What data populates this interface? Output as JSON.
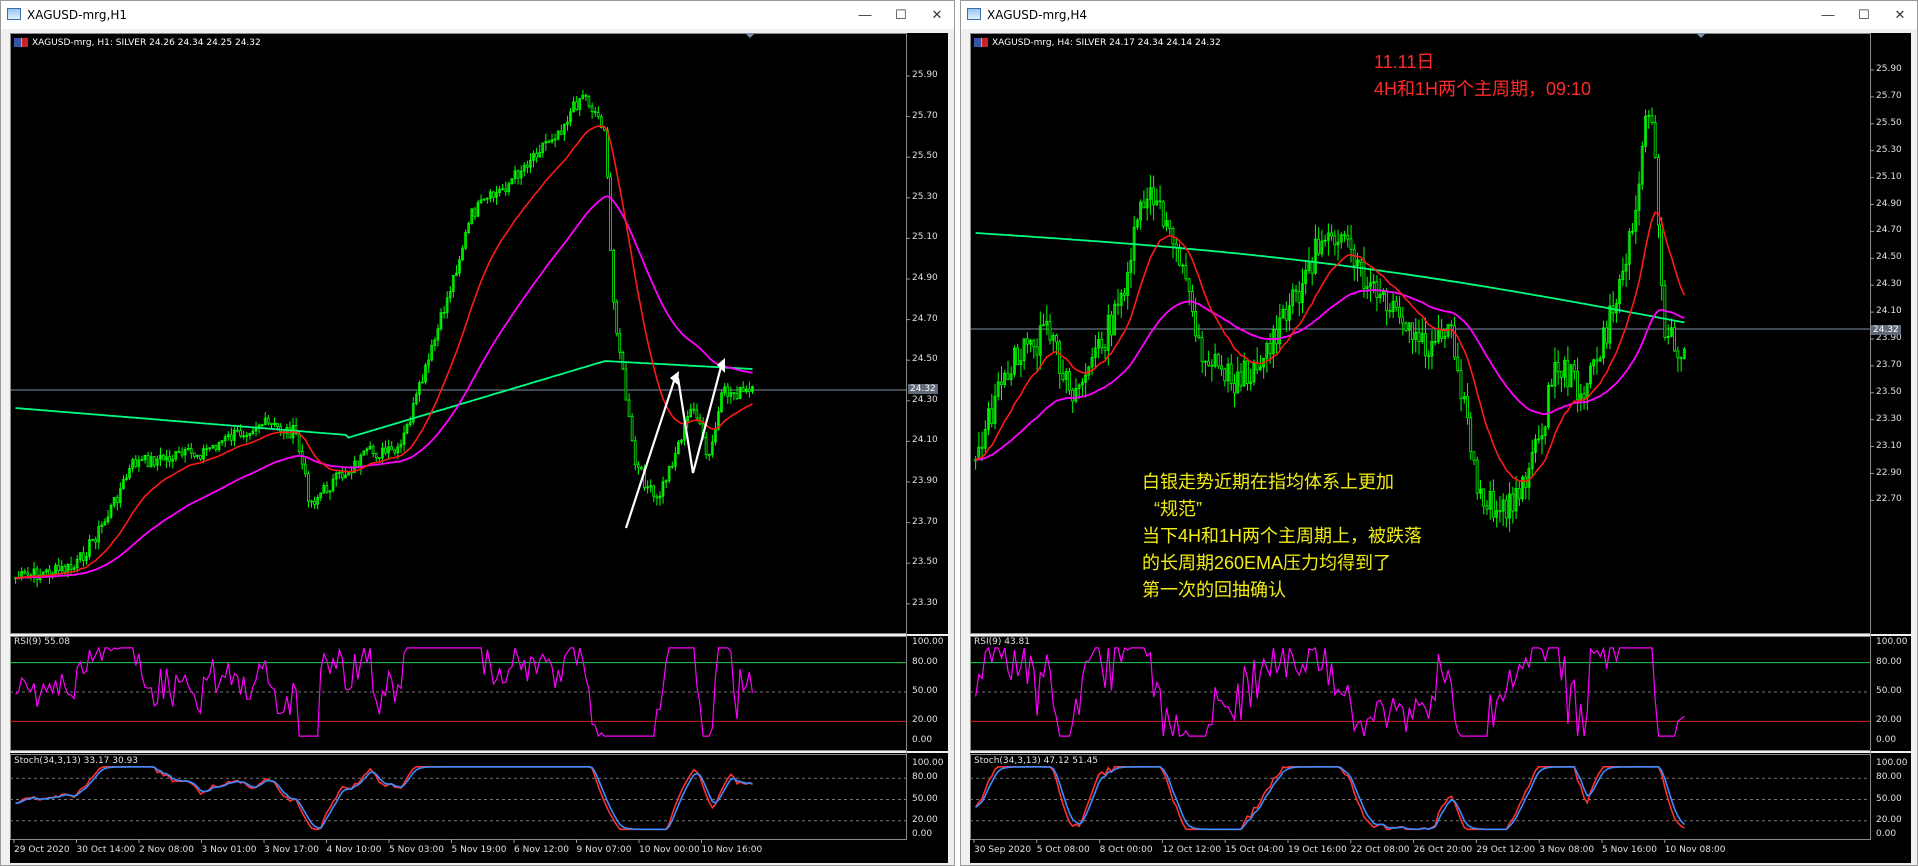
{
  "windows": [
    {
      "title": "XAGUSD-mrg,H1",
      "symbol_info": "XAGUSD-mrg, H1:  SILVER  24.26 24.34 24.25 24.32",
      "current_price": "24.32",
      "price_labels": [
        "25.90",
        "25.70",
        "25.50",
        "25.30",
        "25.10",
        "24.90",
        "24.70",
        "24.50",
        "24.30",
        "24.10",
        "23.90",
        "23.70",
        "23.50",
        "23.30"
      ],
      "rsi_label": "RSI(9) 55.08",
      "rsi_levels": [
        "100.00",
        "80.00",
        "50.00",
        "20.00",
        "0.00"
      ],
      "stoch_label": "Stoch(34,3,13) 33.17 30.93",
      "stoch_levels": [
        "100.00",
        "80.00",
        "50.00",
        "20.00",
        "0.00"
      ],
      "time_labels": [
        "29 Oct 2020",
        "30 Oct 14:00",
        "2 Nov 08:00",
        "3 Nov 01:00",
        "3 Nov 17:00",
        "4 Nov 10:00",
        "5 Nov 03:00",
        "5 Nov 19:00",
        "6 Nov 12:00",
        "9 Nov 07:00",
        "10 Nov 00:00",
        "10 Nov 16:00"
      ]
    },
    {
      "title": "XAGUSD-mrg,H4",
      "symbol_info": "XAGUSD-mrg, H4:  SILVER  24.17 24.34 24.14 24.32",
      "current_price": "24.32",
      "price_labels": [
        "25.90",
        "25.70",
        "25.50",
        "25.30",
        "25.10",
        "24.90",
        "24.70",
        "24.50",
        "24.30",
        "24.10",
        "23.90",
        "23.70",
        "23.50",
        "23.30",
        "23.10",
        "22.90",
        "22.70"
      ],
      "rsi_label": "RSI(9) 43.81",
      "rsi_levels": [
        "100.00",
        "80.00",
        "50.00",
        "20.00",
        "0.00"
      ],
      "stoch_label": "Stoch(34,3,13) 47.12 51.45",
      "stoch_levels": [
        "100.00",
        "80.00",
        "50.00",
        "20.00",
        "0.00"
      ],
      "time_labels": [
        "30 Sep 2020",
        "5 Oct 08:00",
        "8 Oct 00:00",
        "12 Oct 12:00",
        "15 Oct 04:00",
        "19 Oct 16:00",
        "22 Oct 08:00",
        "26 Oct 20:00",
        "29 Oct 12:00",
        "3 Nov 08:00",
        "5 Nov 16:00",
        "10 Nov 08:00"
      ],
      "annotation_red": [
        "11.11日",
        "4H和1H两个主周期，09:10"
      ],
      "annotation_yellow": [
        "白银走势近期在指均体系上更加",
        "“规范”",
        "当下4H和1H两个主周期上，被跌落",
        "的长周期260EMA压力均得到了",
        "第一次的回抽确认"
      ]
    }
  ],
  "window_buttons": {
    "minimize": "—",
    "maximize": "☐",
    "close": "✕"
  },
  "colors": {
    "candle": "#00ff00",
    "ema_fast": "#ff1a1a",
    "ema_mid": "#ff00ff",
    "ema_long": "#00ff7f",
    "rsi": "#ff00ff",
    "stoch_main": "#3d8cff",
    "stoch_signal": "#ff3030"
  }
}
